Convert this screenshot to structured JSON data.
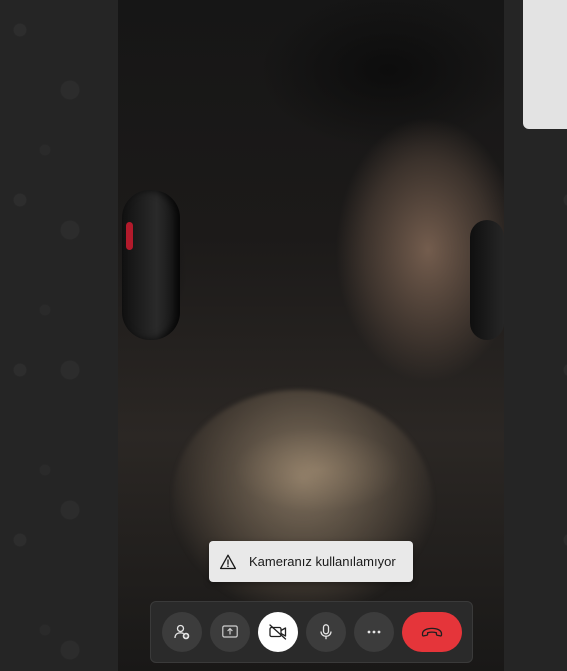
{
  "toast": {
    "message": "Kameranız kullanılamıyor",
    "icon": "warning-icon"
  },
  "toolbar": {
    "buttons": [
      {
        "name": "add-participant-button",
        "icon": "add-person-icon"
      },
      {
        "name": "share-screen-button",
        "icon": "share-screen-icon"
      },
      {
        "name": "camera-toggle-button",
        "icon": "camera-off-icon",
        "state": "off"
      },
      {
        "name": "microphone-button",
        "icon": "microphone-icon"
      },
      {
        "name": "more-options-button",
        "icon": "more-icon"
      },
      {
        "name": "end-call-button",
        "icon": "hang-up-icon"
      }
    ]
  },
  "colors": {
    "end_call": "#e5353a",
    "toast_bg": "#e9e9e9",
    "toolbar_bg": "#2a2a2a",
    "button_bg": "#3c3c3c"
  }
}
